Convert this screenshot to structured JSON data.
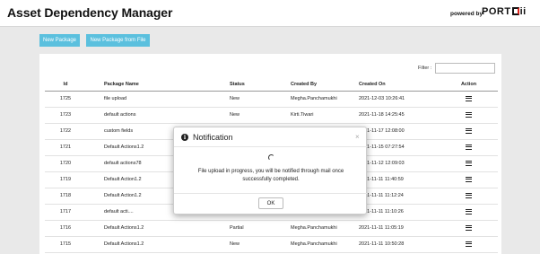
{
  "header": {
    "title": "Asset Dependency Manager",
    "powered_by": "powered by",
    "brand_left": "PORT",
    "brand_right": "ii"
  },
  "toolbar": {
    "new_package": "New Package",
    "new_package_from_file": "New Package from File"
  },
  "filter": {
    "label": "Filter :",
    "value": ""
  },
  "table": {
    "headers": {
      "id": "Id",
      "name": "Package Name",
      "status": "Status",
      "created_by": "Created By",
      "created_on": "Created On",
      "action": "Action"
    },
    "rows": [
      {
        "id": "1725",
        "name": "file upload",
        "status": "New",
        "created_by": "Megha.Panchamukhi",
        "created_on": "2021-12-03 10:26:41"
      },
      {
        "id": "1723",
        "name": "default actions",
        "status": "New",
        "created_by": "Kirti.Tiwari",
        "created_on": "2021-11-18 14:25:45"
      },
      {
        "id": "1722",
        "name": "custom fields",
        "status": "",
        "created_by": "",
        "created_on": "2021-11-17 12:08:00"
      },
      {
        "id": "1721",
        "name": "Default Actions1.2",
        "status": "",
        "created_by": "",
        "created_on": "2021-11-15 07:27:54"
      },
      {
        "id": "1720",
        "name": "default actions78",
        "status": "",
        "created_by": "",
        "created_on": "2021-11-12 12:09:03"
      },
      {
        "id": "1719",
        "name": "Default Action1.2",
        "status": "",
        "created_by": "",
        "created_on": "2021-11-11 11:40:59"
      },
      {
        "id": "1718",
        "name": "Default Action1.2",
        "status": "",
        "created_by": "",
        "created_on": "2021-11-11 11:12:24"
      },
      {
        "id": "1717",
        "name": "default acti....",
        "status": "New",
        "created_by": "Kirti.Tiwari",
        "created_on": "2021-11-11 11:10:26"
      },
      {
        "id": "1716",
        "name": "Default Actions1.2",
        "status": "Partial",
        "created_by": "Megha.Panchamukhi",
        "created_on": "2021-11-11 11:05:19"
      },
      {
        "id": "1715",
        "name": "Default Actions1.2",
        "status": "New",
        "created_by": "Megha.Panchamukhi",
        "created_on": "2021-11-11 10:50:28"
      }
    ]
  },
  "modal": {
    "title": "Notification",
    "close": "×",
    "message": "File upload in progress, you will be notified through mail once successfully completed.",
    "ok": "OK"
  },
  "icons": {
    "info": "info-circle-icon",
    "close": "close-icon",
    "spinner": "loading-spinner-icon",
    "row_action": "hamburger-menu-icon"
  },
  "colors": {
    "accent": "#5bc0de",
    "brand_red": "#e2231a",
    "background": "#e9e9e9"
  }
}
